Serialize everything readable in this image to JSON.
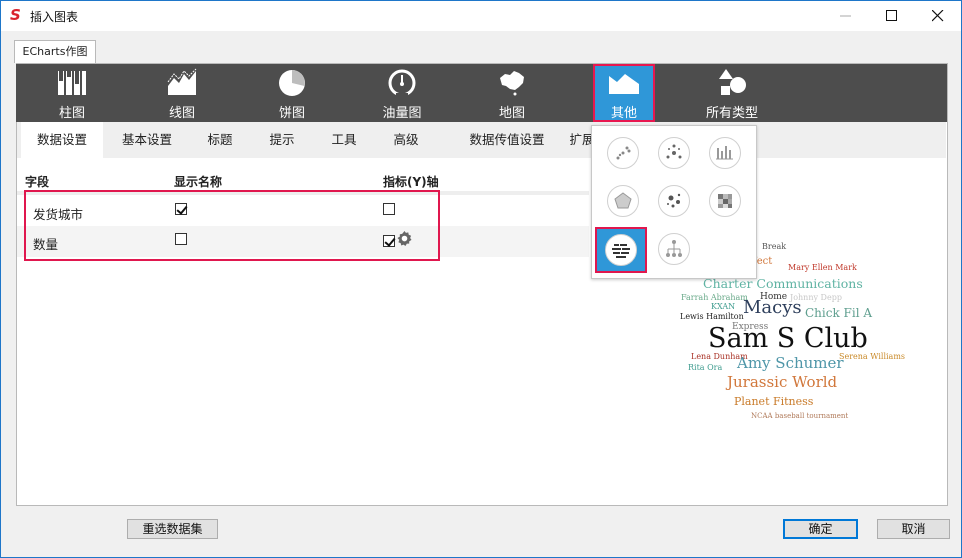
{
  "window": {
    "title": "插入图表",
    "app_logo": "S"
  },
  "controls": {
    "minimize": "—",
    "maximize": "☐",
    "close": "✕"
  },
  "tab": {
    "label": "ECharts作图"
  },
  "toolbar": [
    {
      "label": "柱图",
      "icon": "bar-chart-icon"
    },
    {
      "label": "线图",
      "icon": "line-chart-icon"
    },
    {
      "label": "饼图",
      "icon": "pie-chart-icon"
    },
    {
      "label": "油量图",
      "icon": "gauge-chart-icon"
    },
    {
      "label": "地图",
      "icon": "map-chart-icon"
    },
    {
      "label": "其他",
      "icon": "other-chart-icon",
      "selected": true
    },
    {
      "label": "所有类型",
      "icon": "all-types-icon"
    }
  ],
  "subtabs": [
    "数据设置",
    "基本设置",
    "标题",
    "提示",
    "工具",
    "高级",
    "数据传值设置",
    "扩展"
  ],
  "table": {
    "headers": [
      "字段",
      "显示名称",
      "指标(Y)轴"
    ],
    "rows": [
      {
        "field": "发货城市",
        "show_name": true,
        "y_axis": false
      },
      {
        "field": "数量",
        "show_name": false,
        "y_axis": true
      }
    ]
  },
  "popup": {
    "icons": [
      "scatter-chart-icon",
      "radial-scatter-icon",
      "candlestick-chart-icon",
      "radar-chart-icon",
      "bubble-chart-icon",
      "heatmap-chart-icon",
      "wordcloud-chart-icon",
      "tree-chart-icon"
    ],
    "selected": "wordcloud-chart-icon"
  },
  "wordcloud": [
    {
      "text": "Break",
      "color": "#555555"
    },
    {
      "text": "fect",
      "color": "#d1773b"
    },
    {
      "text": "Mary Ellen Mark",
      "color": "#c0392b"
    },
    {
      "text": "Charter Communications",
      "color": "#5fb3a3"
    },
    {
      "text": "Farrah Abraham",
      "color": "#6aaa8a"
    },
    {
      "text": "Home",
      "color": "#333333"
    },
    {
      "text": "Johnny Depp",
      "color": "#c8c8c8"
    },
    {
      "text": "KXAN",
      "color": "#3f9c8f"
    },
    {
      "text": "Macys",
      "color": "#2e3f5c"
    },
    {
      "text": "Chick Fil A",
      "color": "#5e9e8e"
    },
    {
      "text": "Lewis Hamilton",
      "color": "#222222"
    },
    {
      "text": "Express",
      "color": "#777777"
    },
    {
      "text": "Sam S Club",
      "color": "#111111"
    },
    {
      "text": "Lena Dunham",
      "color": "#a93226"
    },
    {
      "text": "Amy Schumer",
      "color": "#4f96a8"
    },
    {
      "text": "Serena Williams",
      "color": "#c98a2a"
    },
    {
      "text": "Rita Ora",
      "color": "#3f9c8f"
    },
    {
      "text": "Jurassic World",
      "color": "#d1773b"
    },
    {
      "text": "Planet Fitness",
      "color": "#c97b2a"
    },
    {
      "text": "NCAA baseball tournament",
      "color": "#b07a5a"
    }
  ],
  "buttons": {
    "reselect": "重选数据集",
    "ok": "确定",
    "cancel": "取消"
  }
}
